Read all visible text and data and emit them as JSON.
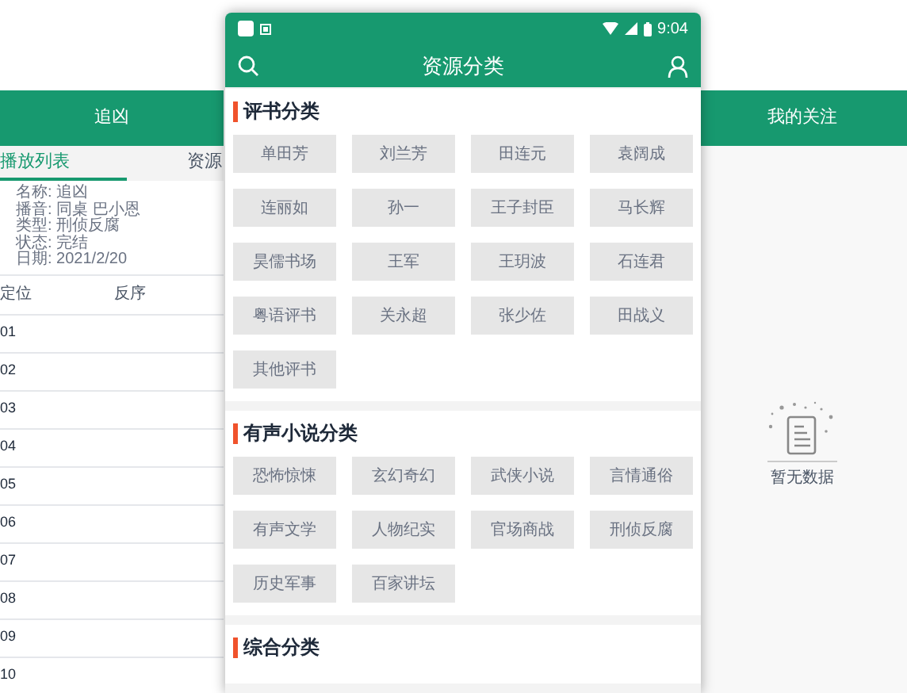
{
  "left_screen": {
    "title": "追凶",
    "tabs": [
      {
        "label": "播放列表",
        "selected": true
      },
      {
        "label": "资源",
        "selected": false
      }
    ],
    "info": [
      "名称: 追凶",
      "播音: 同桌 巴小恩",
      "类型: 刑侦反腐",
      "状态: 完结",
      "日期: 2021/2/20"
    ],
    "controls": [
      "定位",
      "反序"
    ],
    "episodes": [
      "01",
      "02",
      "03",
      "04",
      "05",
      "06",
      "07",
      "08",
      "09",
      "10"
    ]
  },
  "center_screen": {
    "status_bar": {
      "time": "9:04"
    },
    "title": "资源分类",
    "sections": [
      {
        "title": "评书分类",
        "items": [
          "单田芳",
          "刘兰芳",
          "田连元",
          "袁阔成",
          "连丽如",
          "孙一",
          "王子封臣",
          "马长辉",
          "昊儒书场",
          "王军",
          "王玥波",
          "石连君",
          "粤语评书",
          "关永超",
          "张少佐",
          "田战义",
          "其他评书"
        ]
      },
      {
        "title": "有声小说分类",
        "items": [
          "恐怖惊悚",
          "玄幻奇幻",
          "武侠小说",
          "言情通俗",
          "有声文学",
          "人物纪实",
          "官场商战",
          "刑侦反腐",
          "历史军事",
          "百家讲坛"
        ]
      },
      {
        "title": "综合分类"
      }
    ]
  },
  "right_screen": {
    "title": "我的关注",
    "empty_text": "暂无数据"
  }
}
